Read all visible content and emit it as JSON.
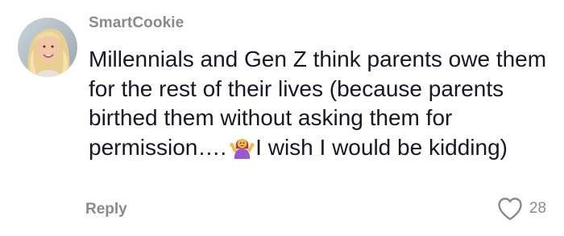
{
  "comment": {
    "username": "SmartCookie",
    "text_before_emoji": "Millennials and Gen Z think parents owe them for the rest of their lives (because parents birthed them without asking them for permission….",
    "emoji": "person-shrugging-emoji",
    "text_after_emoji": "I wish I would be kidding)",
    "reply_label": "Reply",
    "like_count": "28",
    "like_icon": "heart-outline-icon"
  }
}
